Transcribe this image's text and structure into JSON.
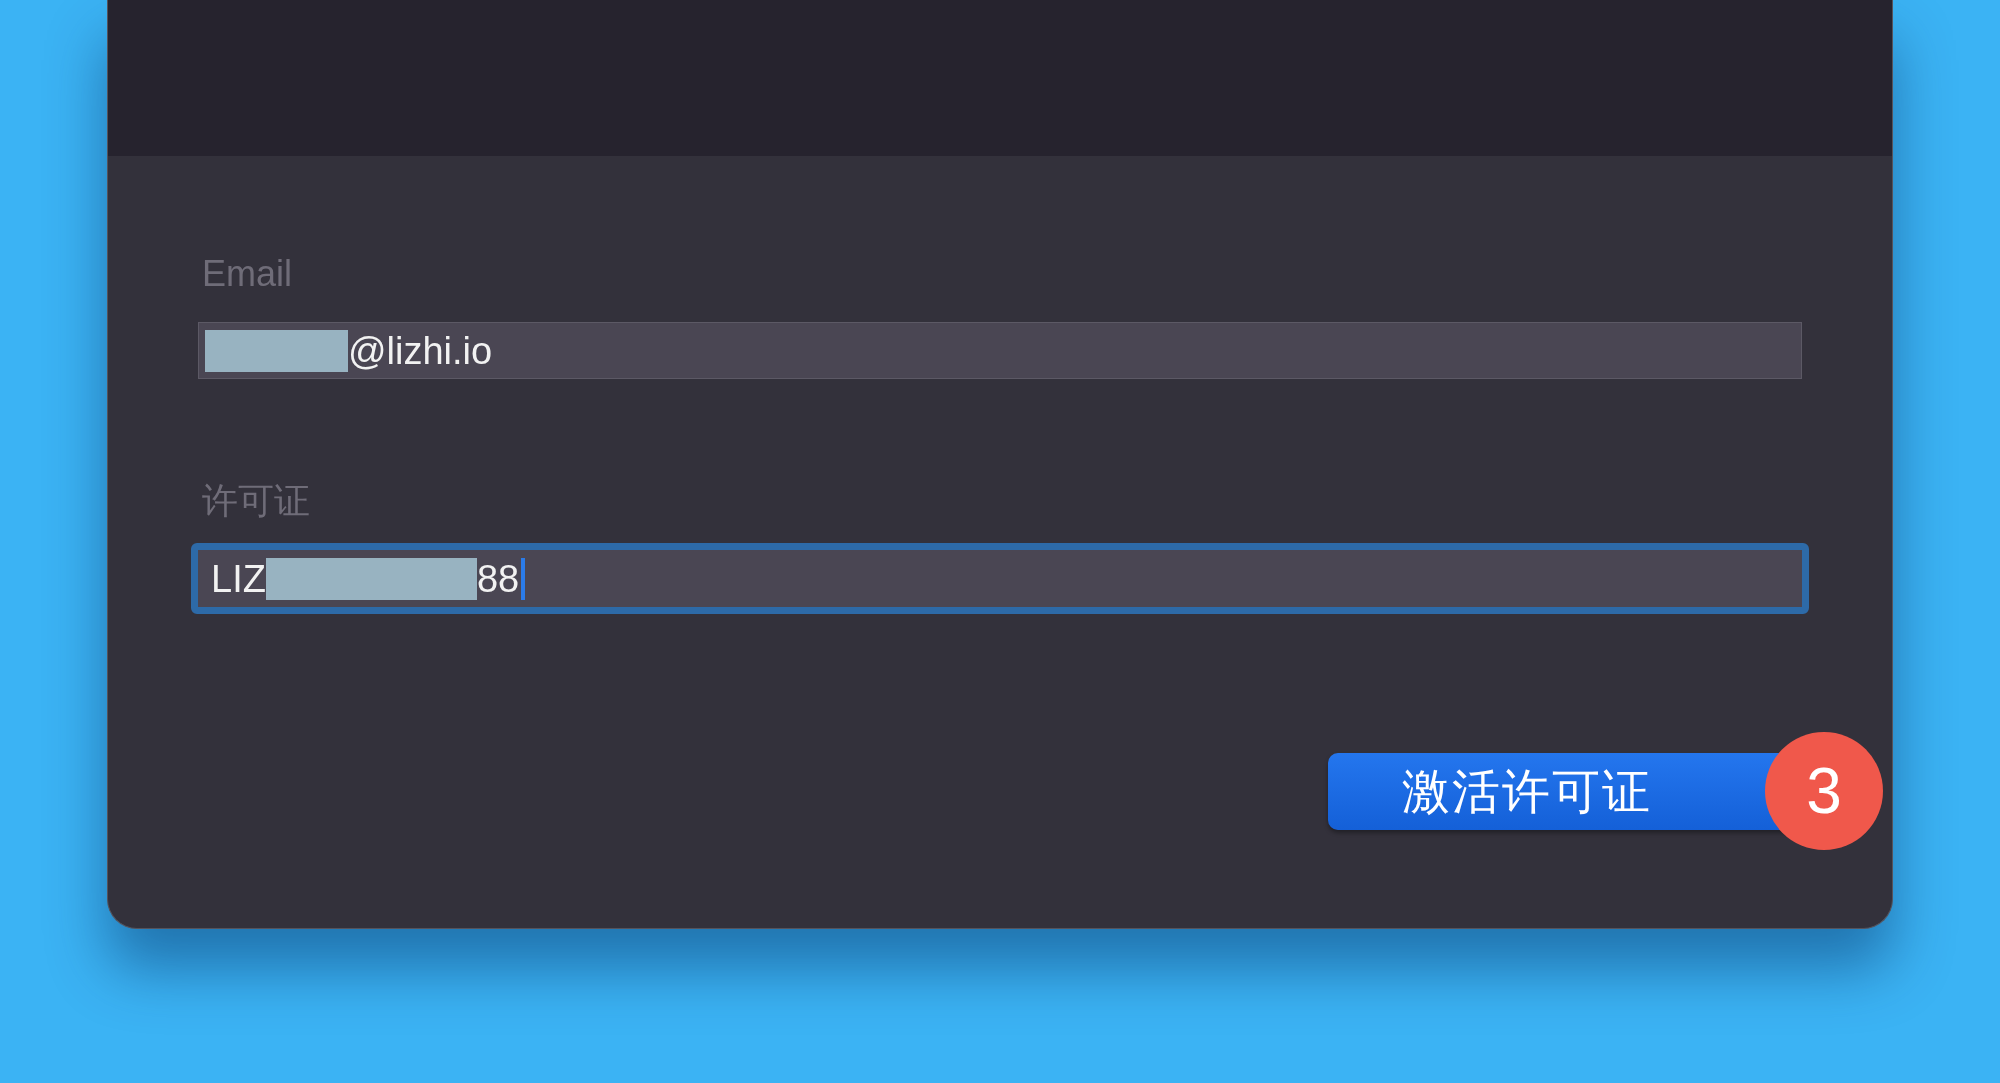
{
  "email": {
    "label": "Email",
    "redacted": true,
    "value": "@lizhi.io"
  },
  "license": {
    "label": "许可证",
    "value_start": "LIZ",
    "redacted": true,
    "value_end": "88",
    "focused": true
  },
  "activate_button": {
    "label": "激活许可证"
  },
  "step_badge": "3"
}
